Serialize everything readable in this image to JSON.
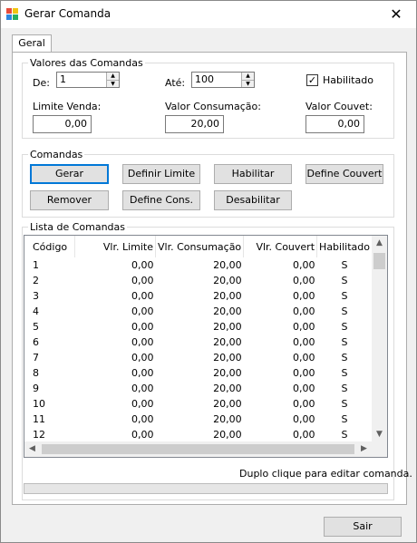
{
  "window": {
    "title": "Gerar Comanda",
    "close_glyph": "✕"
  },
  "tabs": [
    {
      "label": "Geral"
    }
  ],
  "valores": {
    "legend": "Valores das Comandas",
    "de_label": "De:",
    "de_value": "1",
    "ate_label": "Até:",
    "ate_value": "100",
    "habilitado_label": "Habilitado",
    "habilitado_checked": true,
    "limite_label": "Limite Venda:",
    "limite_value": "0,00",
    "consumacao_label": "Valor Consumação:",
    "consumacao_value": "20,00",
    "couvet_label": "Valor Couvet:",
    "couvet_value": "0,00"
  },
  "comandas": {
    "legend": "Comandas",
    "buttons": {
      "gerar": "Gerar",
      "definir_limite": "Definir Limite",
      "habilitar": "Habilitar",
      "define_couvert": "Define Couvert",
      "remover": "Remover",
      "define_cons": "Define Cons.",
      "desabilitar": "Desabilitar"
    }
  },
  "lista": {
    "legend": "Lista de Comandas",
    "columns": [
      "Código",
      "Vlr. Limite",
      "Vlr. Consumação",
      "Vlr. Couvert",
      "Habilitado"
    ],
    "rows": [
      [
        "1",
        "0,00",
        "20,00",
        "0,00",
        "S"
      ],
      [
        "2",
        "0,00",
        "20,00",
        "0,00",
        "S"
      ],
      [
        "3",
        "0,00",
        "20,00",
        "0,00",
        "S"
      ],
      [
        "4",
        "0,00",
        "20,00",
        "0,00",
        "S"
      ],
      [
        "5",
        "0,00",
        "20,00",
        "0,00",
        "S"
      ],
      [
        "6",
        "0,00",
        "20,00",
        "0,00",
        "S"
      ],
      [
        "7",
        "0,00",
        "20,00",
        "0,00",
        "S"
      ],
      [
        "8",
        "0,00",
        "20,00",
        "0,00",
        "S"
      ],
      [
        "9",
        "0,00",
        "20,00",
        "0,00",
        "S"
      ],
      [
        "10",
        "0,00",
        "20,00",
        "0,00",
        "S"
      ],
      [
        "11",
        "0,00",
        "20,00",
        "0,00",
        "S"
      ],
      [
        "12",
        "0,00",
        "20,00",
        "0,00",
        "S"
      ]
    ],
    "hint": "Duplo clique para editar comanda."
  },
  "footer": {
    "sair": "Sair"
  }
}
